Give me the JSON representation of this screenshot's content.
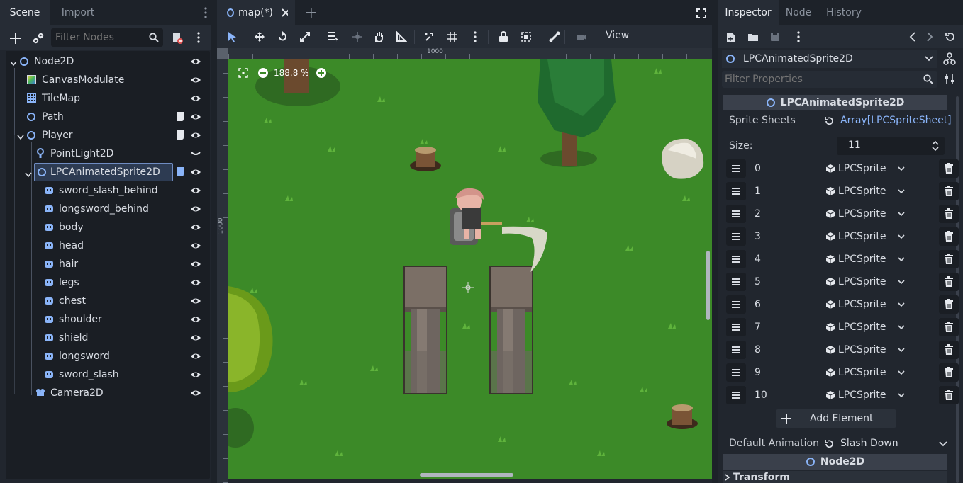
{
  "scene_dock": {
    "tabs": [
      "Scene",
      "Import"
    ],
    "filter_placeholder": "Filter Nodes",
    "nodes": [
      {
        "label": "Node2D"
      },
      {
        "label": "CanvasModulate"
      },
      {
        "label": "TileMap"
      },
      {
        "label": "Path"
      },
      {
        "label": "Player"
      },
      {
        "label": "PointLight2D"
      },
      {
        "label": "LPCAnimatedSprite2D"
      },
      {
        "label": "sword_slash_behind"
      },
      {
        "label": "longsword_behind"
      },
      {
        "label": "body"
      },
      {
        "label": "head"
      },
      {
        "label": "hair"
      },
      {
        "label": "legs"
      },
      {
        "label": "chest"
      },
      {
        "label": "shoulder"
      },
      {
        "label": "shield"
      },
      {
        "label": "longsword"
      },
      {
        "label": "sword_slash"
      },
      {
        "label": "Camera2D"
      }
    ]
  },
  "editor": {
    "tab_label": "map(*)",
    "toolbar_view_label": "View",
    "zoom_label": "188.8 %",
    "ruler_top_label": "1000",
    "ruler_left_label": "1000"
  },
  "inspector": {
    "tabs": [
      "Inspector",
      "Node",
      "History"
    ],
    "object_name": "LPCAnimatedSprite2D",
    "filter_placeholder": "Filter Properties",
    "section_title": "LPCAnimatedSprite2D",
    "sprite_sheets_label": "Sprite Sheets",
    "sprite_sheets_value": "Array[LPCSpriteSheet]",
    "size_label": "Size:",
    "size_value": "11",
    "elements": [
      {
        "index": "0",
        "type": "LPCSprite"
      },
      {
        "index": "1",
        "type": "LPCSprite"
      },
      {
        "index": "2",
        "type": "LPCSprite"
      },
      {
        "index": "3",
        "type": "LPCSprite"
      },
      {
        "index": "4",
        "type": "LPCSprite"
      },
      {
        "index": "5",
        "type": "LPCSprite"
      },
      {
        "index": "6",
        "type": "LPCSprite"
      },
      {
        "index": "7",
        "type": "LPCSprite"
      },
      {
        "index": "8",
        "type": "LPCSprite"
      },
      {
        "index": "9",
        "type": "LPCSprite"
      },
      {
        "index": "10",
        "type": "LPCSprite"
      }
    ],
    "add_element_label": "Add Element",
    "default_animation_label": "Default Animation",
    "default_animation_value": "Slash Down",
    "node2d_section": "Node2D",
    "transform_label": "Transform"
  },
  "colors": {
    "accent": "#6f8cc2",
    "grass": "#3c8a28",
    "link": "#8ab4f8"
  }
}
